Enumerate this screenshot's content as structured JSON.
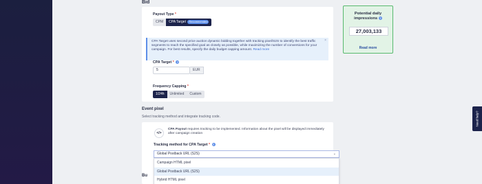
{
  "bid": {
    "section_title": "Bid",
    "payout_type_label": "Payout Type",
    "payout_options": [
      "CPM",
      "CPA Target"
    ],
    "recommended_badge": "Recommended",
    "info_text": "CPA Target uses second price auction dynamic bidding together with tracking pixel/S2S to identify the best traffic segments to reach the specified goal as closely as possible, while maximizing the number of conversions for your campaign. For best results, specify the daily budget capping amount.",
    "info_read_more": "Read more",
    "info_close": "×",
    "cpa_target_label": "CPA Target",
    "cpa_target_value": "5",
    "currency": "EUR",
    "frequency_label": "Frequency Capping",
    "frequency_options": [
      "1/24h",
      "Unlimited",
      "Custom"
    ]
  },
  "event_pixel": {
    "section_title": "Event pixel",
    "subtitle": "Select tracking method and integrate tracking code.",
    "icon_glyph": "</>",
    "cpa_payout_bold": "CPA Payout",
    "cpa_payout_text": " requires tracking to be implemented. Information about the pixel will be displayed immediately after campaign creation",
    "tracking_label": "Tracking method for CPA Target",
    "selected": "Global Postback URL (S2S)",
    "options": [
      "Campaign HTML pixel",
      "Global Postback URL (S2S)",
      "Hybrid HTML pixel"
    ]
  },
  "next_section_partial": "Bu",
  "impressions": {
    "title": "Potential daily impressions",
    "value": "27,003,133",
    "link": "Read more"
  },
  "need_help": "Need help?",
  "req_mark": "*",
  "help_icon": "?",
  "chevron": "⌄"
}
